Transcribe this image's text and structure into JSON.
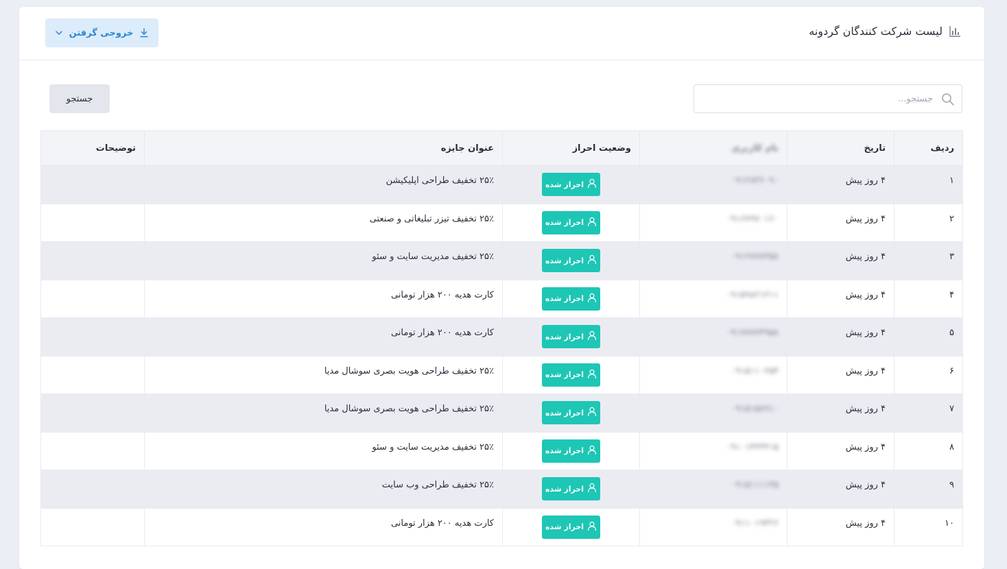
{
  "header": {
    "title": "لیست شرکت کنندگان گردونه",
    "export_label": "خروجی گرفتن"
  },
  "search": {
    "placeholder": "جستجو...",
    "value": "",
    "button_label": "جستجو"
  },
  "table": {
    "columns": [
      "ردیف",
      "تاریخ",
      "نام کاربری",
      "وضعیت احراز",
      "عنوان جایزه",
      "توضیحات"
    ],
    "rows": [
      {
        "index": "۱",
        "date": "۴ روز پیش",
        "username": "۰۹۱۲۸۳۶۰۹۰",
        "status": "احراز شده",
        "prize": "۲۵٪ تخفیف طراحی اپلیکیشن",
        "notes": ""
      },
      {
        "index": "۲",
        "date": "۴ روز پیش",
        "username": "۰۹۱۶۷۹۷۰۱۶۰",
        "status": "احراز شده",
        "prize": "۲۵٪ تخفیف تیزر تبلیغاتی و صنعتی",
        "notes": ""
      },
      {
        "index": "۳",
        "date": "۴ روز پیش",
        "username": "۰۹۱۲۷۷۷۳۵۸",
        "status": "احراز شده",
        "prize": "۲۵٪ تخفیف مدیریت سایت و سئو",
        "notes": ""
      },
      {
        "index": "۴",
        "date": "۴ روز پیش",
        "username": "۰۹۱۵۹۸۲۱۲۱۱",
        "status": "احراز شده",
        "prize": "کارت هدیه ۲۰۰ هزار تومانی",
        "notes": ""
      },
      {
        "index": "۵",
        "date": "۴ روز پیش",
        "username": "۰۹۱۷۷۷۷۳۹۵۸",
        "status": "احراز شده",
        "prize": "کارت هدیه ۲۰۰ هزار تومانی",
        "notes": ""
      },
      {
        "index": "۶",
        "date": "۴ روز پیش",
        "username": "۰۹۱۵۱۱۰۲۵۳",
        "status": "احراز شده",
        "prize": "۲۵٪ تخفیف طراحی هویت بصری سوشال مدیا",
        "notes": ""
      },
      {
        "index": "۷",
        "date": "۴ روز پیش",
        "username": "۰۹۱۵۱۵۸۹۱۰",
        "status": "احراز شده",
        "prize": "۲۵٪ تخفیف طراحی هویت بصری سوشال مدیا",
        "notes": ""
      },
      {
        "index": "۸",
        "date": "۴ روز پیش",
        "username": "۰۹۱۰۱۴۴۴۴۱۵",
        "status": "احراز شده",
        "prize": "۲۵٪ تخفیف مدیریت سایت و سئو",
        "notes": ""
      },
      {
        "index": "۹",
        "date": "۴ روز پیش",
        "username": "۰۹۱۵۱۱۱۱۳۵",
        "status": "احراز شده",
        "prize": "۲۵٪ تخفیف طراحی وب سایت",
        "notes": ""
      },
      {
        "index": "۱۰",
        "date": "۴ روز پیش",
        "username": "۰۹۱۱۰۱۹۳۲۶",
        "status": "احراز شده",
        "prize": "کارت هدیه ۲۰۰ هزار تومانی",
        "notes": ""
      }
    ]
  },
  "colors": {
    "accent": "#1ec6b5",
    "export_bg": "#dcecfa",
    "export_text": "#2d86d6",
    "striped_row": "#ebecf2"
  },
  "icons": {
    "title": "bar-chart-icon",
    "export": "download-icon",
    "dropdown": "chevron-down-icon",
    "search": "search-icon",
    "badge": "user-icon"
  }
}
